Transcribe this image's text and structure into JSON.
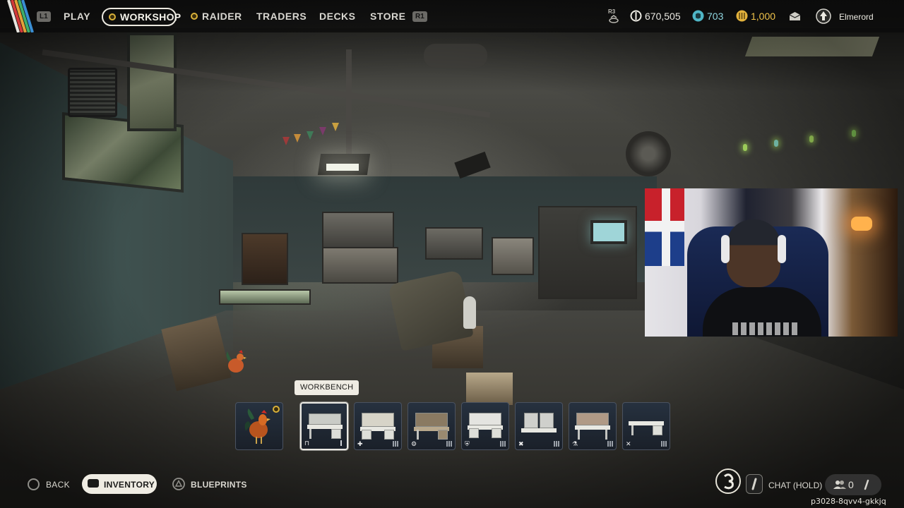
{
  "colors": {
    "accent_gold": "#d9b13a",
    "credit_teal": "#4fb6c6",
    "coin_gold": "#e3b23c",
    "active_pill": "#efece3"
  },
  "topbar": {
    "left_bumper": "L1",
    "right_bumper": "R1",
    "nav": [
      {
        "label": "PLAY",
        "icon": "none"
      },
      {
        "label": "WORKSHOP",
        "icon": "gold-ring-dot",
        "active": true
      },
      {
        "label": "RAIDER",
        "icon": "gold-ring-dot"
      },
      {
        "label": "TRADERS",
        "icon": "none"
      },
      {
        "label": "DECKS",
        "icon": "none"
      },
      {
        "label": "STORE",
        "icon": "none"
      }
    ],
    "r3_hint": "R3",
    "currencies": [
      {
        "icon": "coins-icon",
        "value": "670,505"
      },
      {
        "icon": "raider-token-icon",
        "value": "703"
      },
      {
        "icon": "gold-coins-icon",
        "value": "1,000"
      }
    ],
    "mail_icon": "envelope-icon",
    "username": "Elmerord"
  },
  "hotbar": {
    "tooltip": "WORKBENCH",
    "slots": [
      {
        "name": "rooster",
        "badge": "gold-ring-dot"
      },
      {
        "name": "workbench",
        "selected": true,
        "tier_icon": "bench-icon",
        "level": "I"
      },
      {
        "name": "gunsmith",
        "tier_icon": "plus-icon",
        "level": "III"
      },
      {
        "name": "gear-bench",
        "tier_icon": "gear-icon",
        "level": "III"
      },
      {
        "name": "medical-lab",
        "tier_icon": "shield-icon",
        "level": "III"
      },
      {
        "name": "explosives-station",
        "tier_icon": "crossed-icon",
        "level": "III"
      },
      {
        "name": "utility-station",
        "tier_icon": "flask-icon",
        "level": "III"
      },
      {
        "name": "refiner",
        "tier_icon": "x-icon",
        "level": "III"
      }
    ]
  },
  "bottombar": {
    "back_label": "BACK",
    "inventory_label": "INVENTORY",
    "blueprints_label": "BLUEPRINTS",
    "chat_label": "CHAT (HOLD)",
    "party_count": "0",
    "session_code": "p3028-8qvv4-gkkjq"
  }
}
